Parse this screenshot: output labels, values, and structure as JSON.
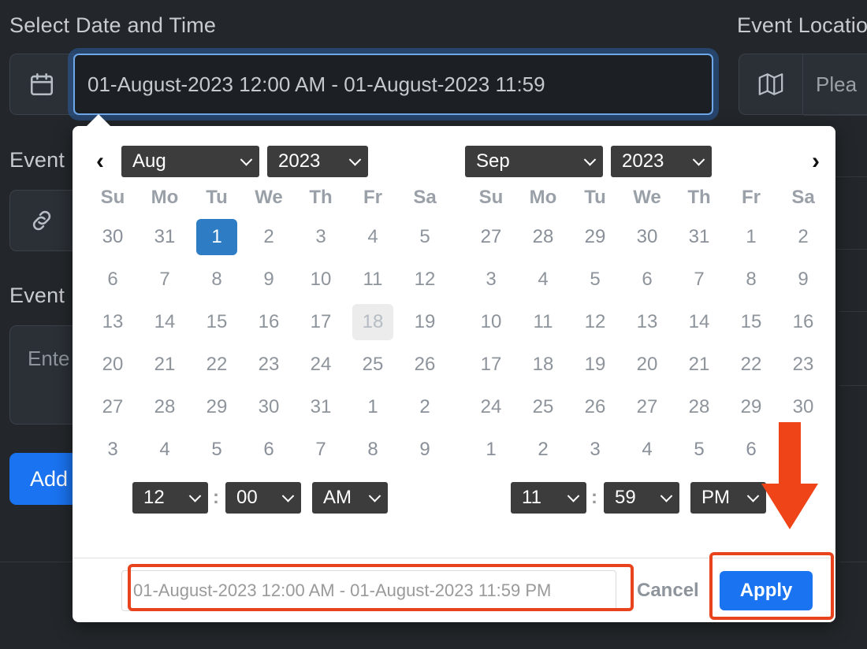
{
  "page": {
    "labels": {
      "datetime": "Select Date and Time",
      "location": "Event Location",
      "event_link": "Event ",
      "event_desc": "Event "
    },
    "datetime_input": {
      "value": "01-August-2023 12:00 AM - 01-August-2023 11:59",
      "icon": "calendar-icon"
    },
    "location_input": {
      "value": "Plea",
      "icon": "map-icon"
    },
    "event_link_input": {
      "value": "",
      "icon": "link-icon"
    },
    "event_desc_input": {
      "value": "Ente"
    },
    "add_button_label": "Add"
  },
  "picker": {
    "left_calendar": {
      "prev_arrow": "‹",
      "month": "Aug",
      "year": "2023",
      "weekdays": [
        "Su",
        "Mo",
        "Tu",
        "We",
        "Th",
        "Fr",
        "Sa"
      ],
      "weeks": [
        [
          {
            "d": "30",
            "state": "adj"
          },
          {
            "d": "31",
            "state": "adj"
          },
          {
            "d": "1",
            "state": "selected"
          },
          {
            "d": "2",
            "state": "cur"
          },
          {
            "d": "3",
            "state": "cur"
          },
          {
            "d": "4",
            "state": "cur"
          },
          {
            "d": "5",
            "state": "cur"
          }
        ],
        [
          {
            "d": "6",
            "state": "cur"
          },
          {
            "d": "7",
            "state": "cur"
          },
          {
            "d": "8",
            "state": "cur"
          },
          {
            "d": "9",
            "state": "cur"
          },
          {
            "d": "10",
            "state": "cur"
          },
          {
            "d": "11",
            "state": "cur"
          },
          {
            "d": "12",
            "state": "cur"
          }
        ],
        [
          {
            "d": "13",
            "state": "cur"
          },
          {
            "d": "14",
            "state": "cur"
          },
          {
            "d": "15",
            "state": "cur"
          },
          {
            "d": "16",
            "state": "cur"
          },
          {
            "d": "17",
            "state": "cur"
          },
          {
            "d": "18",
            "state": "hover"
          },
          {
            "d": "19",
            "state": "cur"
          }
        ],
        [
          {
            "d": "20",
            "state": "cur"
          },
          {
            "d": "21",
            "state": "cur"
          },
          {
            "d": "22",
            "state": "cur"
          },
          {
            "d": "23",
            "state": "cur"
          },
          {
            "d": "24",
            "state": "cur"
          },
          {
            "d": "25",
            "state": "cur"
          },
          {
            "d": "26",
            "state": "cur"
          }
        ],
        [
          {
            "d": "27",
            "state": "cur"
          },
          {
            "d": "28",
            "state": "cur"
          },
          {
            "d": "29",
            "state": "cur"
          },
          {
            "d": "30",
            "state": "cur"
          },
          {
            "d": "31",
            "state": "cur"
          },
          {
            "d": "1",
            "state": "adj"
          },
          {
            "d": "2",
            "state": "adj"
          }
        ],
        [
          {
            "d": "3",
            "state": "adj"
          },
          {
            "d": "4",
            "state": "adj"
          },
          {
            "d": "5",
            "state": "adj"
          },
          {
            "d": "6",
            "state": "adj"
          },
          {
            "d": "7",
            "state": "adj"
          },
          {
            "d": "8",
            "state": "adj"
          },
          {
            "d": "9",
            "state": "adj"
          }
        ]
      ],
      "time": {
        "hour": "12",
        "minute": "00",
        "meridiem": "AM",
        "separator": ":"
      }
    },
    "right_calendar": {
      "next_arrow": "›",
      "month": "Sep",
      "year": "2023",
      "weekdays": [
        "Su",
        "Mo",
        "Tu",
        "We",
        "Th",
        "Fr",
        "Sa"
      ],
      "weeks": [
        [
          {
            "d": "27",
            "state": "adj"
          },
          {
            "d": "28",
            "state": "adj"
          },
          {
            "d": "29",
            "state": "adj"
          },
          {
            "d": "30",
            "state": "adj"
          },
          {
            "d": "31",
            "state": "adj"
          },
          {
            "d": "1",
            "state": "cur"
          },
          {
            "d": "2",
            "state": "cur"
          }
        ],
        [
          {
            "d": "3",
            "state": "cur"
          },
          {
            "d": "4",
            "state": "cur"
          },
          {
            "d": "5",
            "state": "cur"
          },
          {
            "d": "6",
            "state": "cur"
          },
          {
            "d": "7",
            "state": "cur"
          },
          {
            "d": "8",
            "state": "cur"
          },
          {
            "d": "9",
            "state": "cur"
          }
        ],
        [
          {
            "d": "10",
            "state": "cur"
          },
          {
            "d": "11",
            "state": "cur"
          },
          {
            "d": "12",
            "state": "cur"
          },
          {
            "d": "13",
            "state": "cur"
          },
          {
            "d": "14",
            "state": "cur"
          },
          {
            "d": "15",
            "state": "cur"
          },
          {
            "d": "16",
            "state": "cur"
          }
        ],
        [
          {
            "d": "17",
            "state": "cur"
          },
          {
            "d": "18",
            "state": "cur"
          },
          {
            "d": "19",
            "state": "cur"
          },
          {
            "d": "20",
            "state": "cur"
          },
          {
            "d": "21",
            "state": "cur"
          },
          {
            "d": "22",
            "state": "cur"
          },
          {
            "d": "23",
            "state": "cur"
          }
        ],
        [
          {
            "d": "24",
            "state": "cur"
          },
          {
            "d": "25",
            "state": "cur"
          },
          {
            "d": "26",
            "state": "cur"
          },
          {
            "d": "27",
            "state": "cur"
          },
          {
            "d": "28",
            "state": "cur"
          },
          {
            "d": "29",
            "state": "cur"
          },
          {
            "d": "30",
            "state": "cur"
          }
        ],
        [
          {
            "d": "1",
            "state": "adj"
          },
          {
            "d": "2",
            "state": "adj"
          },
          {
            "d": "3",
            "state": "adj"
          },
          {
            "d": "4",
            "state": "adj"
          },
          {
            "d": "5",
            "state": "adj"
          },
          {
            "d": "6",
            "state": "adj"
          },
          {
            "d": "",
            "state": "cur"
          }
        ]
      ],
      "time": {
        "hour": "11",
        "minute": "59",
        "meridiem": "PM",
        "separator": ":"
      }
    },
    "footer": {
      "range_text": "01-August-2023 12:00 AM - 01-August-2023 11:59 PM",
      "cancel_label": "Cancel",
      "apply_label": "Apply"
    }
  },
  "annotations": {
    "highlight_color": "#e8431c",
    "arrow": "down-arrow",
    "boxes": [
      "range-display",
      "apply-button"
    ]
  },
  "colors": {
    "accent_blue": "#1a73f0",
    "selected_day_blue": "#2e7cc3",
    "annotation_orange": "#e8431c",
    "dark_bg": "#23272b"
  }
}
